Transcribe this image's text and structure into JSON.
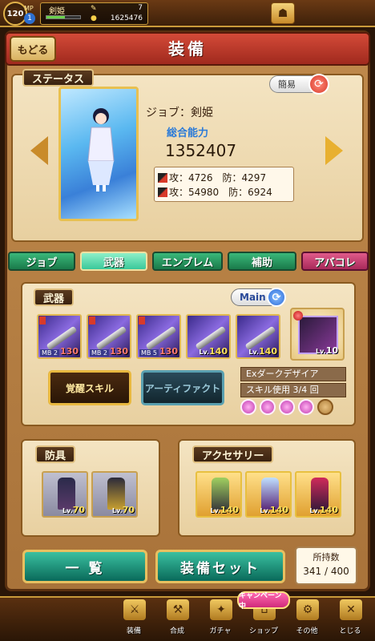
{
  "topbar": {
    "level": "120",
    "mp_label": "MP",
    "mp_value": "1",
    "player_name": "剣姫",
    "exp_fraction": 0.55,
    "stamina": "7",
    "gold": "1625476"
  },
  "header": {
    "title": "装備",
    "back_label": "もどる"
  },
  "status": {
    "section_label": "ステータス",
    "simple_label": "簡易",
    "job_label": "ジョブ：剣姫",
    "power_label": "総合能力",
    "power_value": "1352407",
    "row1": "攻：4726　防：4297",
    "row2": "攻：54980　防：6924"
  },
  "tabs": [
    {
      "label": "ジョブ"
    },
    {
      "label": "武器"
    },
    {
      "label": "エンブレム"
    },
    {
      "label": "補助"
    },
    {
      "label": "アバコレ"
    }
  ],
  "weapons": {
    "section_label": "武器",
    "main_label": "Main",
    "items": [
      {
        "mb": "MB 2",
        "value": "130"
      },
      {
        "mb": "MB 2",
        "value": "130"
      },
      {
        "mb": "MB 5",
        "value": "130"
      },
      {
        "lv": "140"
      },
      {
        "lv": "140"
      }
    ],
    "special_lv": "10",
    "awaken_label": "覚醒スキル",
    "artifact_label": "アーティファクト",
    "skill_name": "Exダークデザイア",
    "skill_use": "スキル使用 3/4 回"
  },
  "armor": {
    "section_label": "防具",
    "items": [
      {
        "lv": "70"
      },
      {
        "lv": "70"
      }
    ]
  },
  "accessory": {
    "section_label": "アクセサリー",
    "items": [
      {
        "lv": "140"
      },
      {
        "lv": "140"
      },
      {
        "lv": "140"
      }
    ]
  },
  "bottom_buttons": {
    "list_label": "一 覧",
    "set_label": "装備セット",
    "owned_label": "所持数",
    "owned_value": "341 / 400"
  },
  "nav": [
    {
      "label": "装備",
      "icon": "sword-icon"
    },
    {
      "label": "合成",
      "icon": "hammer-icon"
    },
    {
      "label": "ガチャ",
      "icon": "gacha-icon"
    },
    {
      "label": "ショップ",
      "icon": "shop-icon"
    },
    {
      "label": "その他",
      "icon": "gear-icon"
    },
    {
      "label": "とじる",
      "icon": "close-icon"
    }
  ],
  "event_badge": "キャンペーン中",
  "colors": {
    "accent": "#d44a38",
    "tab_green": "#3ab87a",
    "tab_pink": "#e05a8a"
  }
}
